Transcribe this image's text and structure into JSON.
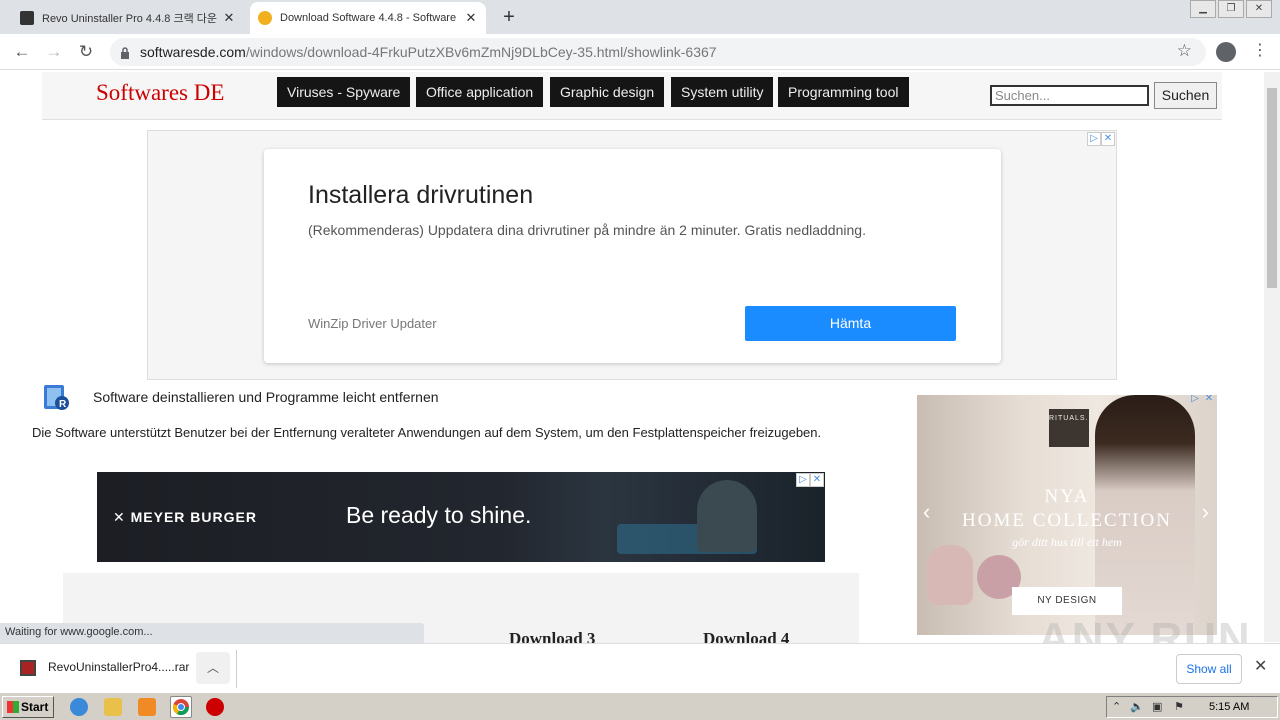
{
  "browser": {
    "tabs": [
      {
        "title": "Revo Uninstaller Pro 4.4.8 크랙 다운"
      },
      {
        "title": "Download Software 4.4.8 - Software"
      }
    ],
    "url_domain": "softwaresde.com",
    "url_path": "/windows/download-4FrkuPutzXBv6mZmNj9DLbCey-35.html/showlink-6367"
  },
  "site": {
    "logo": "Softwares DE",
    "nav": [
      "Viruses - Spyware",
      "Office application",
      "Graphic design",
      "System utility",
      "Programming tool"
    ],
    "search_placeholder": "Suchen...",
    "search_button": "Suchen"
  },
  "ad_top": {
    "title": "Installera drivrutinen",
    "desc": "(Rekommenderas) Uppdatera dina drivrutiner på mindre än 2 minuter. Gratis nedladdning.",
    "brand": "WinZip Driver Updater",
    "button": "Hämta"
  },
  "content": {
    "app_title": "Software deinstallieren und Programme leicht entfernen",
    "app_desc": "Die Software unterstützt Benutzer bei der Entfernung veralteter Anwendungen auf dem System, um den Festplattenspeicher freizugeben.",
    "download3": "Download 3",
    "download4": "Download 4"
  },
  "ad_banner": {
    "brand": "MEYER BURGER",
    "slogan": "Be ready to shine."
  },
  "ad_side": {
    "logo": "RITUALS...",
    "headline1": "NYA",
    "headline2": "HOME COLLECTION",
    "sub": "gör ditt hus till ett hem",
    "button": "NY DESIGN"
  },
  "status": "Waiting for www.google.com...",
  "download_shelf": {
    "file": "RevoUninstallerPro4.....rar",
    "show_all": "Show all"
  },
  "taskbar": {
    "start": "Start",
    "clock": "5:15 AM"
  },
  "watermark": "ANY RUN"
}
